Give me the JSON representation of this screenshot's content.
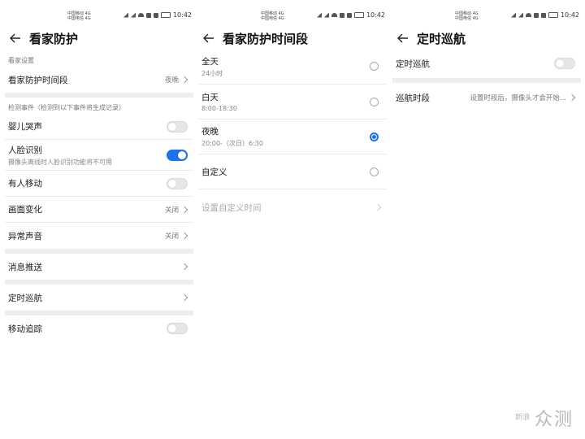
{
  "status": {
    "carrier_line1": "中国移动 4G",
    "carrier_line2": "中国电信 4G",
    "time": "10:42"
  },
  "panel1": {
    "title": "看家防护",
    "section1": "看家设置",
    "period_label": "看家防护时间段",
    "period_value": "夜晚",
    "section2": "检测事件（检测到以下事件将生成记录）",
    "baby_cry": "婴儿哭声",
    "face": "人脸识别",
    "face_sub": "摄像头离线时人脸识别功能将不可用",
    "motion": "有人移动",
    "scene_change": "画面变化",
    "scene_change_value": "关闭",
    "abnormal_sound": "异常声音",
    "abnormal_sound_value": "关闭",
    "push": "消息推送",
    "patrol": "定时巡航",
    "tracking": "移动追踪"
  },
  "panel2": {
    "title": "看家防护时间段",
    "opt1": "全天",
    "opt1_sub": "24小时",
    "opt2": "白天",
    "opt2_sub": "8:00-18:30",
    "opt3": "夜晚",
    "opt3_sub": "20:00-（次日）6:30",
    "opt4": "自定义",
    "custom_time": "设置自定义时间",
    "selected": "夜晚"
  },
  "panel3": {
    "title": "定时巡航",
    "patrol": "定时巡航",
    "period_label": "巡航时段",
    "period_value": "设置时段后，摄像头才会开始..."
  },
  "watermark": {
    "logo": "新浪",
    "text": "众测"
  },
  "colors": {
    "accent": "#1a73e8"
  }
}
